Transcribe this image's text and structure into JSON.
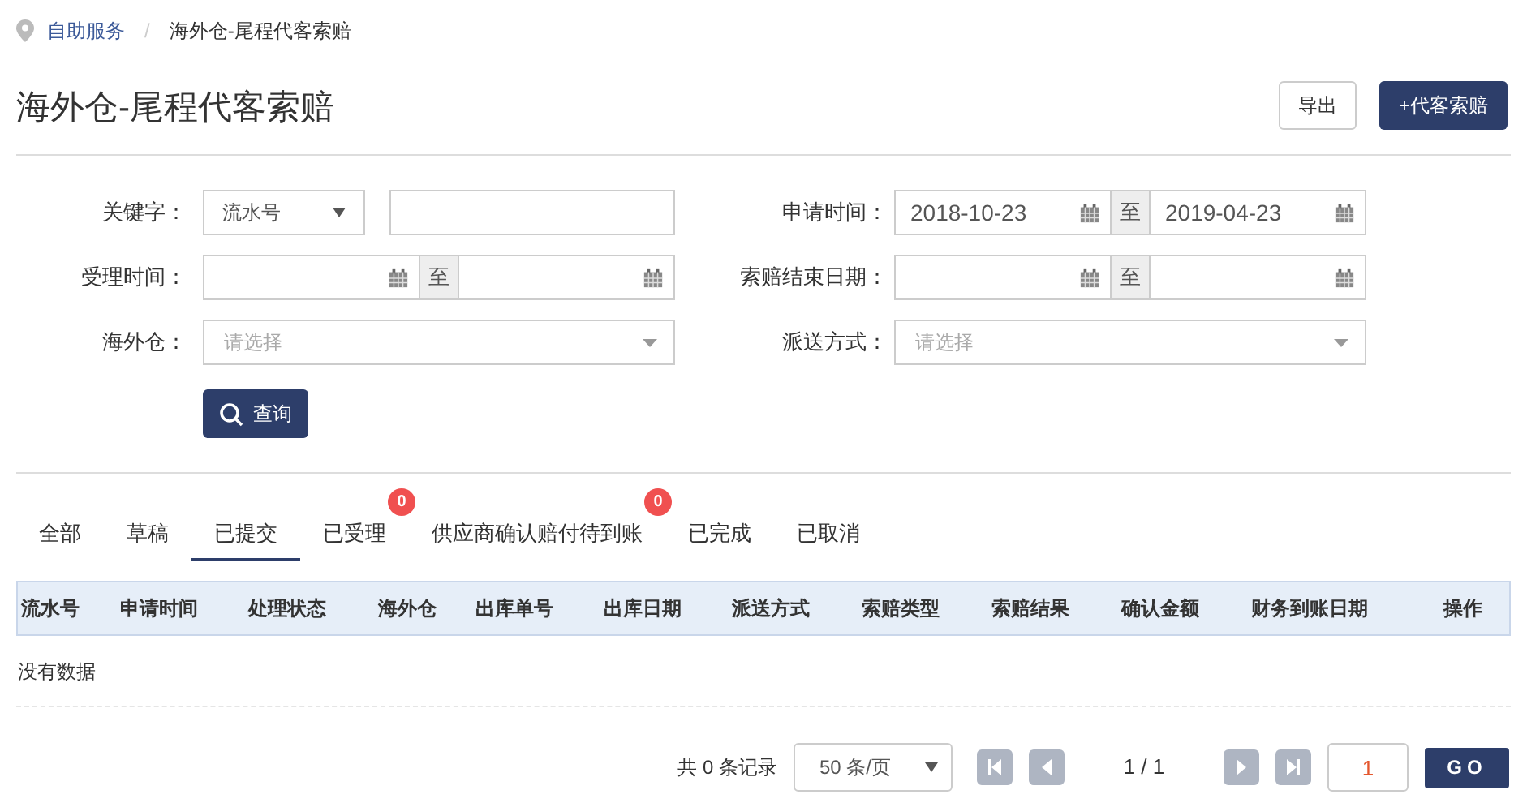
{
  "breadcrumb": [
    {
      "label": "自助服务",
      "link": true
    },
    {
      "label": "海外仓-尾程代客索赔",
      "link": false
    }
  ],
  "breadcrumb_separator": "/",
  "title": "海外仓-尾程代客索赔",
  "header_buttons": [
    {
      "label": "导出",
      "kind": "secondary"
    },
    {
      "label": "+代客索赔",
      "kind": "primary"
    }
  ],
  "filters": [
    {
      "label": "关键字：",
      "kind": "keyword",
      "select_value": "流水号"
    },
    {
      "label": "申请时间：",
      "kind": "date_range",
      "from": "2018-10-23",
      "separator": "至",
      "to": "2019-04-23"
    },
    {
      "label": "受理时间：",
      "kind": "date_range",
      "separator": "至"
    },
    {
      "label": "索赔结束日期：",
      "kind": "date_range",
      "separator": "至"
    },
    {
      "label": "海外仓：",
      "kind": "select",
      "placeholder": "请选择"
    },
    {
      "label": "派送方式：",
      "kind": "select",
      "placeholder": "请选择"
    }
  ],
  "search_button": "查询",
  "tabs": [
    {
      "label": "全部",
      "selected": false
    },
    {
      "label": "草稿",
      "selected": false
    },
    {
      "label": "已提交",
      "selected": true
    },
    {
      "label": "已受理",
      "selected": false,
      "badge": "0"
    },
    {
      "label": "供应商确认赔付待到账",
      "selected": false,
      "badge": "0"
    },
    {
      "label": "已完成",
      "selected": false
    },
    {
      "label": "已取消",
      "selected": false
    }
  ],
  "table": {
    "columns": [
      "流水号",
      "申请时间",
      "处理状态",
      "海外仓",
      "出库单号",
      "出库日期",
      "派送方式",
      "索赔类型",
      "索赔结果",
      "确认金额",
      "财务到账日期",
      "操作"
    ],
    "empty_message": "没有数据"
  },
  "pagination": {
    "total": "共 0 条记录",
    "page_size": "50 条/页",
    "nav_buttons": [
      {
        "kind": "first",
        "disabled": true
      },
      {
        "kind": "prev",
        "disabled": true
      },
      {
        "kind": "next",
        "disabled": true
      },
      {
        "kind": "last",
        "disabled": true
      }
    ],
    "page_info": "1 / 1",
    "page_input": "1",
    "go": "GO"
  }
}
